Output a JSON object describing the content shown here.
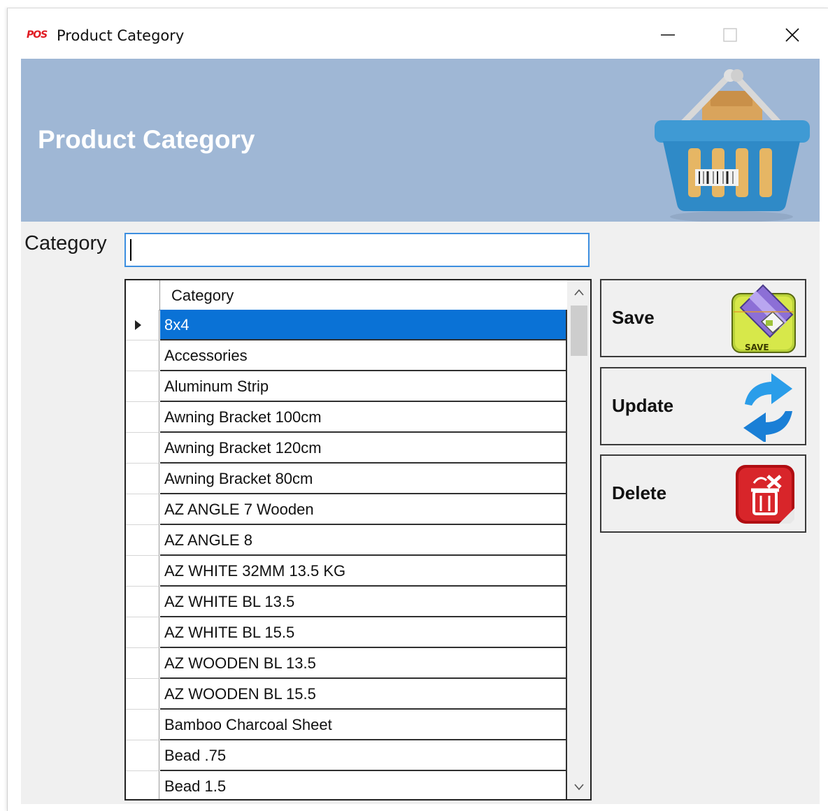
{
  "window": {
    "app_logo": "POS",
    "title": "Product Category"
  },
  "header": {
    "title": "Product Category"
  },
  "form": {
    "category_label": "Category",
    "category_value": ""
  },
  "grid": {
    "column_header": "Category",
    "rows": [
      "8x4",
      "Accessories",
      "Aluminum Strip",
      "Awning Bracket 100cm",
      "Awning Bracket 120cm",
      "Awning Bracket 80cm",
      "AZ ANGLE 7 Wooden",
      "AZ ANGLE 8",
      "AZ WHITE 32MM 13.5 KG",
      "AZ WHITE BL 13.5",
      "AZ WHITE BL 15.5",
      "AZ WOODEN BL 13.5",
      "AZ WOODEN BL 15.5",
      "Bamboo Charcoal Sheet",
      "Bead .75",
      "Bead 1.5"
    ],
    "selected_index": 0
  },
  "buttons": {
    "save": "Save",
    "update": "Update",
    "delete": "Delete",
    "save_icon_text": "SAVE"
  },
  "colors": {
    "header_bg": "#9fb7d5",
    "selection": "#0a72d6",
    "input_border": "#3d8fe0"
  }
}
